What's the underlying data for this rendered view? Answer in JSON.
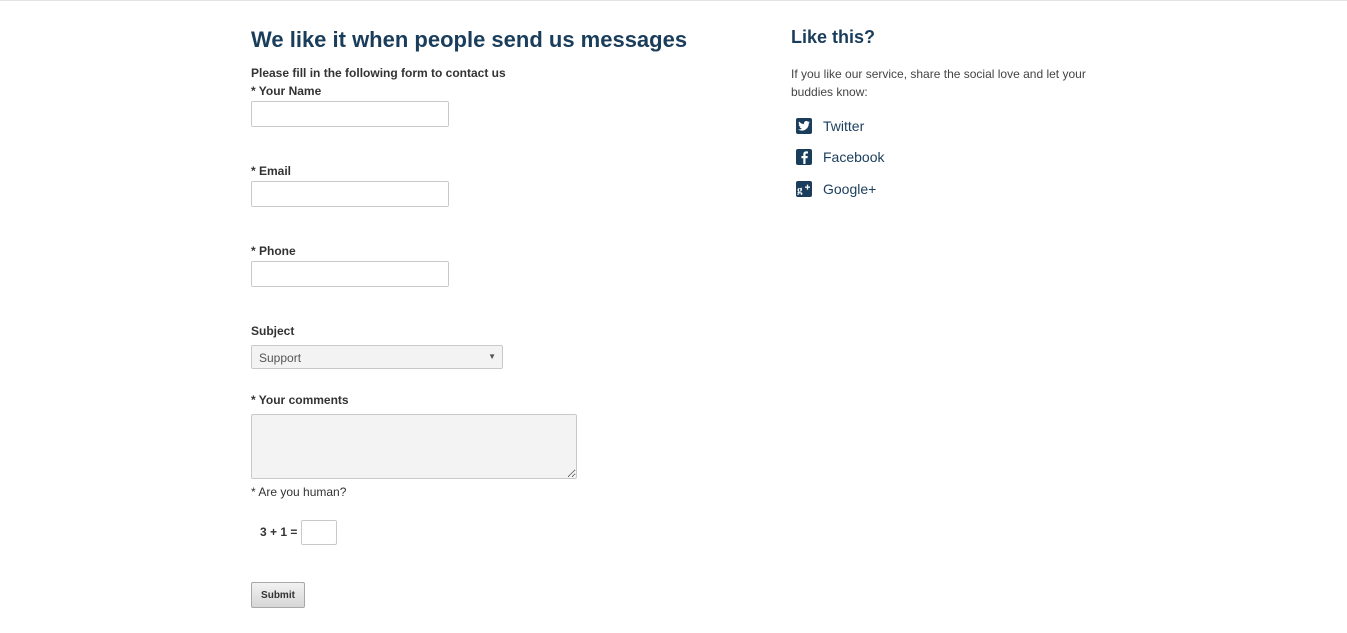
{
  "form": {
    "title": "We like it when people send us messages",
    "intro": "Please fill in the following form to contact us",
    "name_label": "* Your Name",
    "email_label": "* Email",
    "phone_label": "* Phone",
    "subject_label": "Subject",
    "subject_value": "Support",
    "comments_label": "* Your comments",
    "human_label": "* Are you human?",
    "captcha_question": "3 + 1 =",
    "submit_label": "Submit"
  },
  "sidebar": {
    "title": "Like this?",
    "text": "If you like our service, share the social love and let your buddies know:",
    "social": [
      {
        "label": "Twitter",
        "icon": "twitter-icon"
      },
      {
        "label": "Facebook",
        "icon": "facebook-icon"
      },
      {
        "label": "Google+",
        "icon": "google-plus-icon"
      }
    ]
  },
  "colors": {
    "heading": "#1a3d5c",
    "text": "#333333",
    "border": "#c9c9c9"
  }
}
